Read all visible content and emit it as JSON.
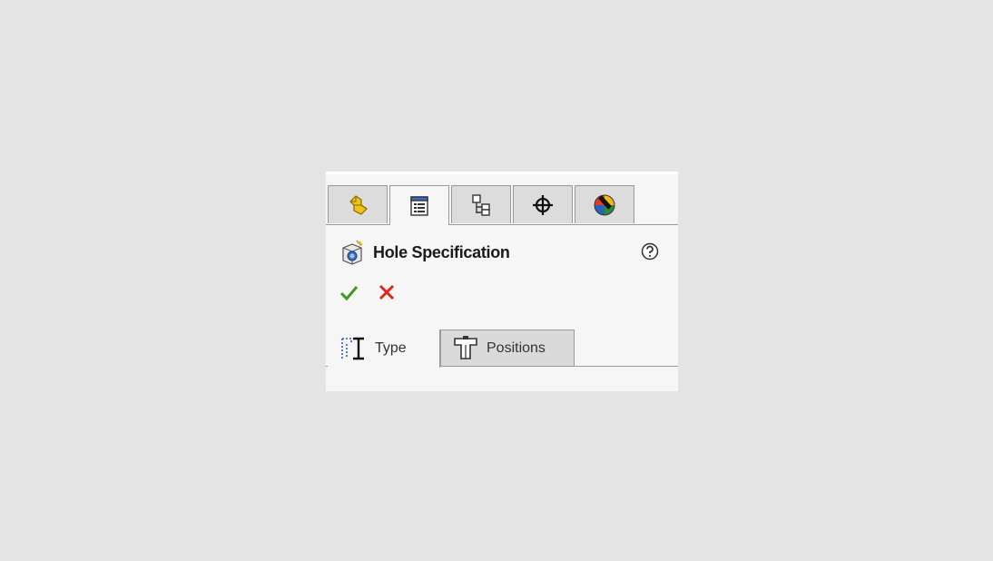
{
  "manager_tabs": [
    {
      "icon": "feature-manager-icon",
      "active": false
    },
    {
      "icon": "property-manager-icon",
      "active": true
    },
    {
      "icon": "configuration-manager-icon",
      "active": false
    },
    {
      "icon": "dimxpert-manager-icon",
      "active": false
    },
    {
      "icon": "display-manager-icon",
      "active": false
    }
  ],
  "header": {
    "title": "Hole Specification",
    "icon": "hole-wizard-icon",
    "help_icon": "help-icon"
  },
  "actions": {
    "ok_icon": "checkmark-icon",
    "cancel_icon": "close-icon",
    "ok_color": "#3a9a22",
    "cancel_color": "#e0261b"
  },
  "subtabs": [
    {
      "label": "Type",
      "icon": "type-icon",
      "active": true
    },
    {
      "label": "Positions",
      "icon": "positions-icon",
      "active": false
    }
  ]
}
